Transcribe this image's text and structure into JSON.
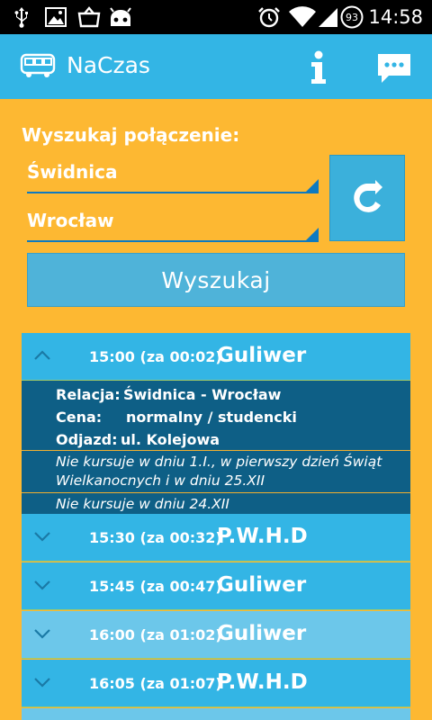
{
  "status_bar": {
    "time": "14:58",
    "battery": "93",
    "icons": [
      "usb-icon",
      "image-icon",
      "shopping-bag-icon",
      "android-icon",
      "alarm-icon",
      "wifi-icon",
      "signal-icon",
      "battery-icon"
    ]
  },
  "action_bar": {
    "title": "NaCzas",
    "icons": [
      "bus-icon",
      "info-icon",
      "chat-icon"
    ]
  },
  "form": {
    "label": "Wyszukaj połączenie:",
    "from": "Świdnica",
    "to": "Wrocław",
    "search_label": "Wyszukaj"
  },
  "results": [
    {
      "time": "15:00 (za 00:02)",
      "carrier": "Guliwer",
      "expanded": true,
      "details": {
        "relacja_label": "Relacja:",
        "relacja": "Świdnica - Wrocław",
        "cena_label": "Cena:",
        "cena": "normalny /  studencki",
        "odjazd_label": "Odjazd:",
        "odjazd": "ul. Kolejowa",
        "note1": "Nie kursuje w dniu 1.I., w pierwszy dzień Świąt Wielkanocnych i w dniu 25.XII",
        "note2": "Nie kursuje w dniu 24.XII"
      }
    },
    {
      "time": "15:30 (za 00:32)",
      "carrier": "P.W.H.D",
      "expanded": false
    },
    {
      "time": "15:45 (za 00:47)",
      "carrier": "Guliwer",
      "expanded": false
    },
    {
      "time": "16:00 (za 01:02)",
      "carrier": "Guliwer",
      "expanded": false
    },
    {
      "time": "16:05 (za 01:07)",
      "carrier": "P.W.H.D",
      "expanded": false
    }
  ],
  "colors": {
    "background": "#fdb832",
    "accent": "#33b5e5",
    "details": "#0e5f86"
  }
}
